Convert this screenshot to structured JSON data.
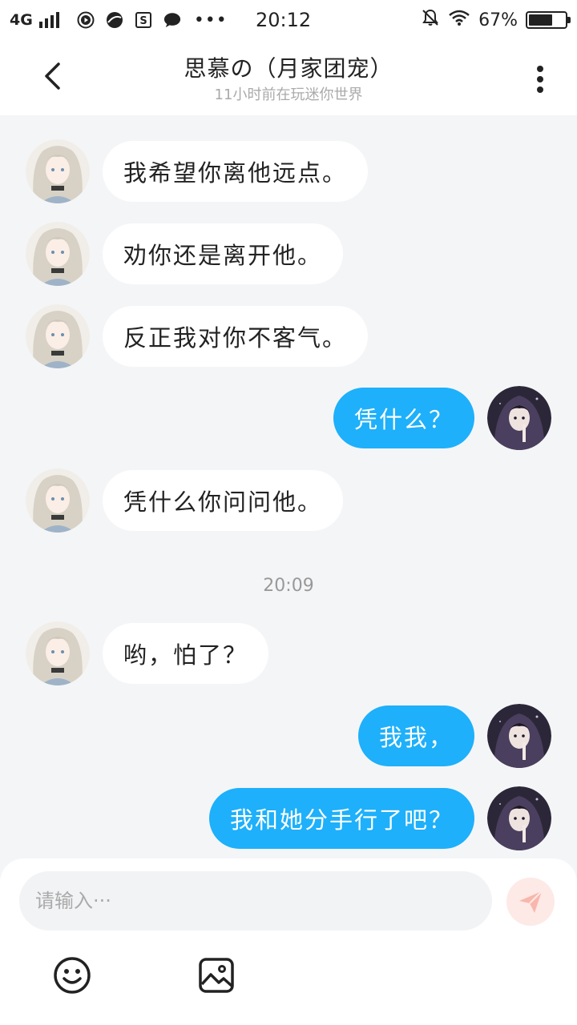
{
  "status_bar": {
    "network": "4G",
    "time": "20:12",
    "battery_percent": "67%",
    "battery_level": 0.67,
    "more": "•••",
    "icons": [
      "video-app-icon",
      "browser-app-icon",
      "s-app-icon",
      "chat-app-icon",
      "mute-icon",
      "wifi-icon",
      "battery-icon"
    ]
  },
  "header": {
    "title": "思慕の（月家团宠）",
    "subtitle": "11小时前在玩迷你世界"
  },
  "colors": {
    "outgoing_bubble": "#1eb0fa",
    "incoming_bubble": "#ffffff",
    "background": "#f4f5f7",
    "send_button": "#fde9e6"
  },
  "messages": [
    {
      "side": "left",
      "text": "我希望你离他远点。"
    },
    {
      "side": "left",
      "text": "劝你还是离开他。"
    },
    {
      "side": "left",
      "text": "反正我对你不客气。"
    },
    {
      "side": "right",
      "text": "凭什么？"
    },
    {
      "side": "left",
      "text": "凭什么你问问他。"
    },
    {
      "type": "time",
      "text": "20:09"
    },
    {
      "side": "left",
      "text": "哟，怕了？"
    },
    {
      "side": "right",
      "text": "我我，"
    },
    {
      "side": "right",
      "text": "我和她分手行了吧？"
    }
  ],
  "input": {
    "placeholder": "请输入···",
    "value": ""
  }
}
